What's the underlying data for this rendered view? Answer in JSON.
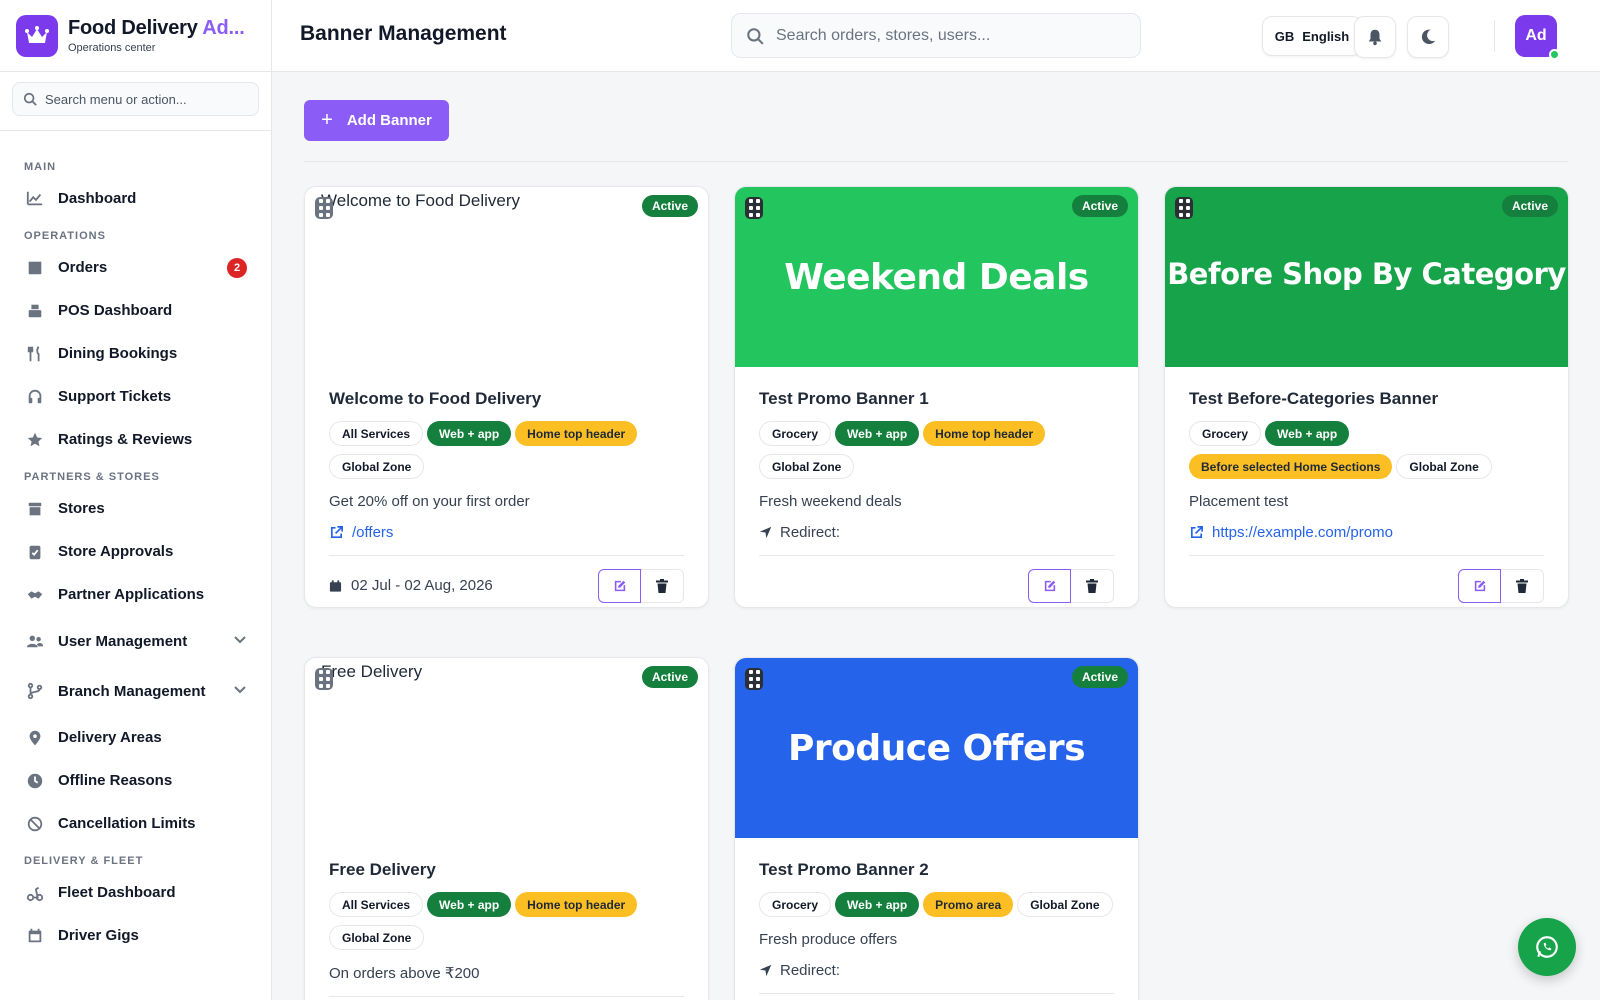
{
  "brand": {
    "name_main": "Food Delivery ",
    "name_accent": "Ad...",
    "subtitle": "Operations center"
  },
  "sidebar": {
    "search_placeholder": "Search menu or action...",
    "sections": [
      {
        "title": "MAIN",
        "items": [
          {
            "label": "Dashboard",
            "icon": "chart-line-icon"
          }
        ]
      },
      {
        "title": "OPERATIONS",
        "items": [
          {
            "label": "Orders",
            "icon": "box-icon",
            "badge": "2"
          },
          {
            "label": "POS Dashboard",
            "icon": "cash-register-icon"
          },
          {
            "label": "Dining Bookings",
            "icon": "utensils-icon"
          },
          {
            "label": "Support Tickets",
            "icon": "headset-icon"
          },
          {
            "label": "Ratings & Reviews",
            "icon": "star-icon"
          }
        ]
      },
      {
        "title": "PARTNERS & STORES",
        "items": [
          {
            "label": "Stores",
            "icon": "store-icon"
          },
          {
            "label": "Store Approvals",
            "icon": "clipboard-check-icon"
          },
          {
            "label": "Partner Applications",
            "icon": "handshake-icon"
          },
          {
            "label": "User Management",
            "icon": "users-icon",
            "expandable": true
          },
          {
            "label": "Branch Management",
            "icon": "branch-icon",
            "expandable": true
          },
          {
            "label": "Delivery Areas",
            "icon": "map-pin-icon"
          },
          {
            "label": "Offline Reasons",
            "icon": "clock-icon"
          },
          {
            "label": "Cancellation Limits",
            "icon": "ban-icon"
          }
        ]
      },
      {
        "title": "DELIVERY & FLEET",
        "items": [
          {
            "label": "Fleet Dashboard",
            "icon": "scooter-icon"
          },
          {
            "label": "Driver Gigs",
            "icon": "calendar-icon"
          }
        ]
      }
    ]
  },
  "header": {
    "title": "Banner Management",
    "search_placeholder": "Search orders, stores, users...",
    "language_flag": "GB",
    "language_label": "English",
    "avatar_initials": "Ad"
  },
  "toolbar": {
    "add_label": "Add Banner"
  },
  "banners": [
    {
      "title": "Welcome to Food Delivery",
      "status": "Active",
      "image_alt": "Welcome to Food Delivery",
      "banner_text": "",
      "banner_color": "",
      "broken": true,
      "tags": [
        {
          "text": "All Services",
          "style": "outline"
        },
        {
          "text": "Web + app",
          "style": "green"
        },
        {
          "text": "Home top header",
          "style": "amber"
        },
        {
          "text": "Global Zone",
          "style": "outline"
        }
      ],
      "description": "Get 20% off on your first order",
      "link": "/offers",
      "redirect": "",
      "date": "02 Jul - 02 Aug, 2026"
    },
    {
      "title": "Test Promo Banner 1",
      "status": "Active",
      "image_alt": "",
      "banner_text": "Weekend Deals",
      "banner_color": "#22c55e",
      "broken": false,
      "tags": [
        {
          "text": "Grocery",
          "style": "outline"
        },
        {
          "text": "Web + app",
          "style": "green"
        },
        {
          "text": "Home top header",
          "style": "amber"
        },
        {
          "text": "Global Zone",
          "style": "outline"
        }
      ],
      "description": "Fresh weekend deals",
      "link": "",
      "redirect": "Redirect:",
      "date": ""
    },
    {
      "title": "Test Before-Categories Banner",
      "status": "Active",
      "image_alt": "",
      "banner_text": "Before Shop By Category",
      "banner_color": "#16a34a",
      "broken": false,
      "tags": [
        {
          "text": "Grocery",
          "style": "outline"
        },
        {
          "text": "Web + app",
          "style": "green"
        },
        {
          "text": "Before selected Home Sections",
          "style": "amber"
        },
        {
          "text": "Global Zone",
          "style": "outline"
        }
      ],
      "description": "Placement test",
      "link": "https://example.com/promo",
      "redirect": "",
      "date": ""
    },
    {
      "title": "Free Delivery",
      "status": "Active",
      "image_alt": "Free Delivery",
      "banner_text": "",
      "banner_color": "",
      "broken": true,
      "tags": [
        {
          "text": "All Services",
          "style": "outline"
        },
        {
          "text": "Web + app",
          "style": "green"
        },
        {
          "text": "Home top header",
          "style": "amber"
        },
        {
          "text": "Global Zone",
          "style": "outline"
        }
      ],
      "description": "On orders above ₹200",
      "link": "",
      "redirect": "",
      "date": ""
    },
    {
      "title": "Test Promo Banner 2",
      "status": "Active",
      "image_alt": "",
      "banner_text": "Produce Offers",
      "banner_color": "#2563eb",
      "broken": false,
      "tags": [
        {
          "text": "Grocery",
          "style": "outline"
        },
        {
          "text": "Web + app",
          "style": "green"
        },
        {
          "text": "Promo area",
          "style": "amber"
        },
        {
          "text": "Global Zone",
          "style": "outline"
        }
      ],
      "description": "Fresh produce offers",
      "link": "",
      "redirect": "Redirect:",
      "date": ""
    }
  ],
  "colors": {
    "accent": "#8b5cf6",
    "active_badge": "#15803d",
    "whatsapp": "#16a34a"
  }
}
